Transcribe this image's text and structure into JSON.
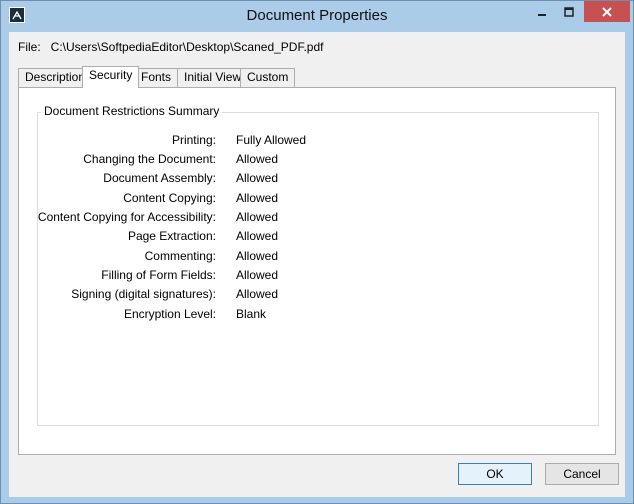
{
  "window": {
    "title": "Document Properties"
  },
  "file": {
    "label": "File:",
    "path": "C:\\Users\\SoftpediaEditor\\Desktop\\Scaned_PDF.pdf"
  },
  "tabs": [
    {
      "label": "Description"
    },
    {
      "label": "Security"
    },
    {
      "label": "Fonts"
    },
    {
      "label": "Initial View"
    },
    {
      "label": "Custom"
    }
  ],
  "security": {
    "group_title": "Document Restrictions Summary",
    "rows": [
      {
        "label": "Printing:",
        "value": "Fully Allowed"
      },
      {
        "label": "Changing the Document:",
        "value": "Allowed"
      },
      {
        "label": "Document Assembly:",
        "value": "Allowed"
      },
      {
        "label": "Content Copying:",
        "value": "Allowed"
      },
      {
        "label": "Content Copying for Accessibility:",
        "value": "Allowed"
      },
      {
        "label": "Page Extraction:",
        "value": "Allowed"
      },
      {
        "label": "Commenting:",
        "value": "Allowed"
      },
      {
        "label": "Filling of Form Fields:",
        "value": "Allowed"
      },
      {
        "label": "Signing (digital signatures):",
        "value": "Allowed"
      },
      {
        "label": "Encryption Level:",
        "value": "Blank"
      }
    ]
  },
  "buttons": {
    "ok": "OK",
    "cancel": "Cancel"
  },
  "colors": {
    "titlebar": "#aacce8",
    "close_button": "#c75050",
    "dialog_bg": "#f0f0f0"
  }
}
